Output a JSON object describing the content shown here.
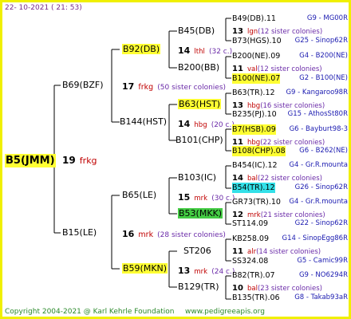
{
  "header": {
    "date": "22- 10-2021 ( 21: 53)"
  },
  "root": {
    "name": "B5(JMM)",
    "gen": "19",
    "species": "frkg"
  },
  "gen1": [
    {
      "name": "B69(BZF)"
    },
    {
      "name": "B15(LE)"
    }
  ],
  "gen2": [
    {
      "name": "B92(DB)",
      "gen": "17",
      "species": "frkg",
      "sisters": "(50 sister colonies)"
    },
    {
      "name": "B144(HST)"
    },
    {
      "name": "B65(LE)",
      "gen": "16",
      "species": "mrk",
      "sisters": "(28 sister colonies)"
    },
    {
      "name": "B59(MKN)"
    }
  ],
  "gen3": [
    {
      "name": "B45(DB)",
      "gen": "14",
      "species": "lthl",
      "sisters": "(32 c.)"
    },
    {
      "name": "B200(BB)"
    },
    {
      "name": "B63(HST)",
      "gen": "14",
      "species": "hbg",
      "sisters": "(20 c.)"
    },
    {
      "name": "B101(CHP)"
    },
    {
      "name": "B103(IC)",
      "gen": "15",
      "species": "mrk",
      "sisters": "(30 c.)"
    },
    {
      "name": "B53(MKK)"
    },
    {
      "name": "ST206",
      "gen": "13",
      "species": "mrk",
      "sisters": "(24 c.)"
    },
    {
      "name": "B129(TR)"
    }
  ],
  "gen4": [
    {
      "name": "B49(DB).11",
      "loc": "G9 - MG00R"
    },
    {
      "name_gen": "13",
      "species": "lgn",
      "sisters": "(12 sister colonies)"
    },
    {
      "name": "B73(HGS).10",
      "loc": "G25 - Sinop62R"
    },
    {
      "name": "B200(NE).09",
      "loc": "G4 - B200(NE)"
    },
    {
      "name_gen": "11",
      "species": "val",
      "sisters": "(12 sister colonies)"
    },
    {
      "name": "B100(NE).07",
      "loc": "G2 - B100(NE)"
    },
    {
      "name": "B63(TR).12",
      "loc": "G9 - Kangaroo98R"
    },
    {
      "name_gen": "13",
      "species": "hbg",
      "sisters": "(16 sister colonies)"
    },
    {
      "name": "B235(PJ).10",
      "loc": "G15 - AthosSt80R"
    },
    {
      "name": "B7(HSB).09",
      "loc": "G6 - Bayburt98-3"
    },
    {
      "name_gen": "11",
      "species": "hbg",
      "sisters": "(22 sister colonies)"
    },
    {
      "name": "B108(CHP).08",
      "loc": "G6 - B262(NE)"
    },
    {
      "name": "B454(IC).12",
      "loc": "G4 - Gr.R.mounta"
    },
    {
      "name_gen": "14",
      "species": "bal",
      "sisters": "(22 sister colonies)"
    },
    {
      "name": "B54(TR).12",
      "loc": "G26 - Sinop62R"
    },
    {
      "name": "GR73(TR).10",
      "loc": "G4 - Gr.R.mounta"
    },
    {
      "name_gen": "12",
      "species": "mrk",
      "sisters": "(21 sister colonies)"
    },
    {
      "name": "ST114.09",
      "loc": "G22 - Sinop62R"
    },
    {
      "name": "KB258.09",
      "loc": "G14 - SinopEgg86R"
    },
    {
      "name_gen": "11",
      "species": "alr",
      "sisters": "(14 sister colonies)"
    },
    {
      "name": "SS324.08",
      "loc": "G5 - Camic99R"
    },
    {
      "name": "B82(TR).07",
      "loc": "G9 - NO6294R"
    },
    {
      "name_gen": "10",
      "species": "bal",
      "sisters": "(23 sister colonies)"
    },
    {
      "name": "B135(TR).06",
      "loc": "G8 - Takab93aR"
    }
  ],
  "footer": {
    "copyright": "Copyright 2004-2021 @ Karl Kehrle Foundation",
    "url": "www.pedigreeapis.org"
  }
}
